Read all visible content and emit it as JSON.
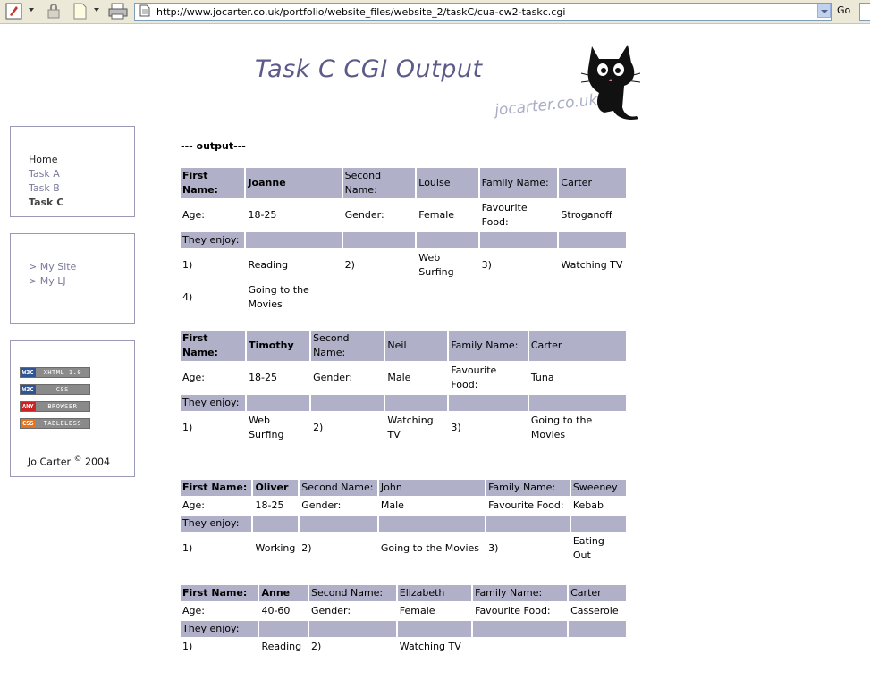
{
  "browser": {
    "url": "http://www.jocarter.co.uk/portfolio/website_files/website_2/taskC/cua-cw2-taskc.cgi",
    "go_label": "Go"
  },
  "header": {
    "title": "Task C CGI Output",
    "site_name": "jocarter.co.uk"
  },
  "nav": {
    "items": [
      {
        "label": "Home"
      },
      {
        "label": "Task A"
      },
      {
        "label": "Task B"
      },
      {
        "label": "Task C"
      }
    ]
  },
  "links": {
    "items": [
      {
        "label": "> My Site"
      },
      {
        "label": "> My LJ"
      }
    ]
  },
  "badges": [
    {
      "left": "W3C",
      "right": "XHTML 1.0",
      "colors": {
        "left": "#2f5597",
        "right": "#8a8a8a"
      }
    },
    {
      "left": "W3C",
      "right": "CSS",
      "colors": {
        "left": "#2f5597",
        "right": "#8a8a8a"
      }
    },
    {
      "left": "ANY",
      "right": "BROWSER",
      "colors": {
        "left": "#cc2222",
        "right": "#8a8a8a"
      }
    },
    {
      "left": "CSS",
      "right": "TABLELESS",
      "colors": {
        "left": "#e8731c",
        "right": "#8a8a8a"
      }
    }
  ],
  "footer": {
    "author": "Jo Carter",
    "copyright_symbol": "©",
    "year": "2004"
  },
  "main": {
    "output_label": "--- output---",
    "labels": {
      "first_name": "First Name:",
      "second_name": "Second Name:",
      "family_name": "Family Name:",
      "age": "Age:",
      "gender": "Gender:",
      "favourite_food": "Favourite Food:",
      "they_enjoy": "They enjoy:"
    },
    "people": [
      {
        "first": "Joanne",
        "second": "Louise",
        "family": "Carter",
        "age": "18-25",
        "gender": "Female",
        "food": "Stroganoff",
        "hobbies": [
          {
            "n": "1)",
            "v": "Reading"
          },
          {
            "n": "2)",
            "v": "Web Surfing"
          },
          {
            "n": "3)",
            "v": "Watching TV"
          },
          {
            "n": "4)",
            "v": "Going to the Movies"
          }
        ]
      },
      {
        "first": "Timothy",
        "second": "Neil",
        "family": "Carter",
        "age": "18-25",
        "gender": "Male",
        "food": "Tuna",
        "hobbies": [
          {
            "n": "1)",
            "v": "Web Surfing"
          },
          {
            "n": "2)",
            "v": "Watching TV"
          },
          {
            "n": "3)",
            "v": "Going to the Movies"
          }
        ]
      },
      {
        "first": "Oliver",
        "second": "John",
        "family": "Sweeney",
        "age": "18-25",
        "gender": "Male",
        "food": "Kebab",
        "hobbies": [
          {
            "n": "1)",
            "v": "Working"
          },
          {
            "n": "2)",
            "v": "Going to the Movies"
          },
          {
            "n": "3)",
            "v": "Eating Out"
          }
        ]
      },
      {
        "first": "Anne",
        "second": "Elizabeth",
        "family": "Carter",
        "age": "40-60",
        "gender": "Female",
        "food": "Casserole",
        "hobbies": [
          {
            "n": "1)",
            "v": "Reading"
          },
          {
            "n": "2)",
            "v": "Watching TV"
          }
        ]
      }
    ]
  }
}
